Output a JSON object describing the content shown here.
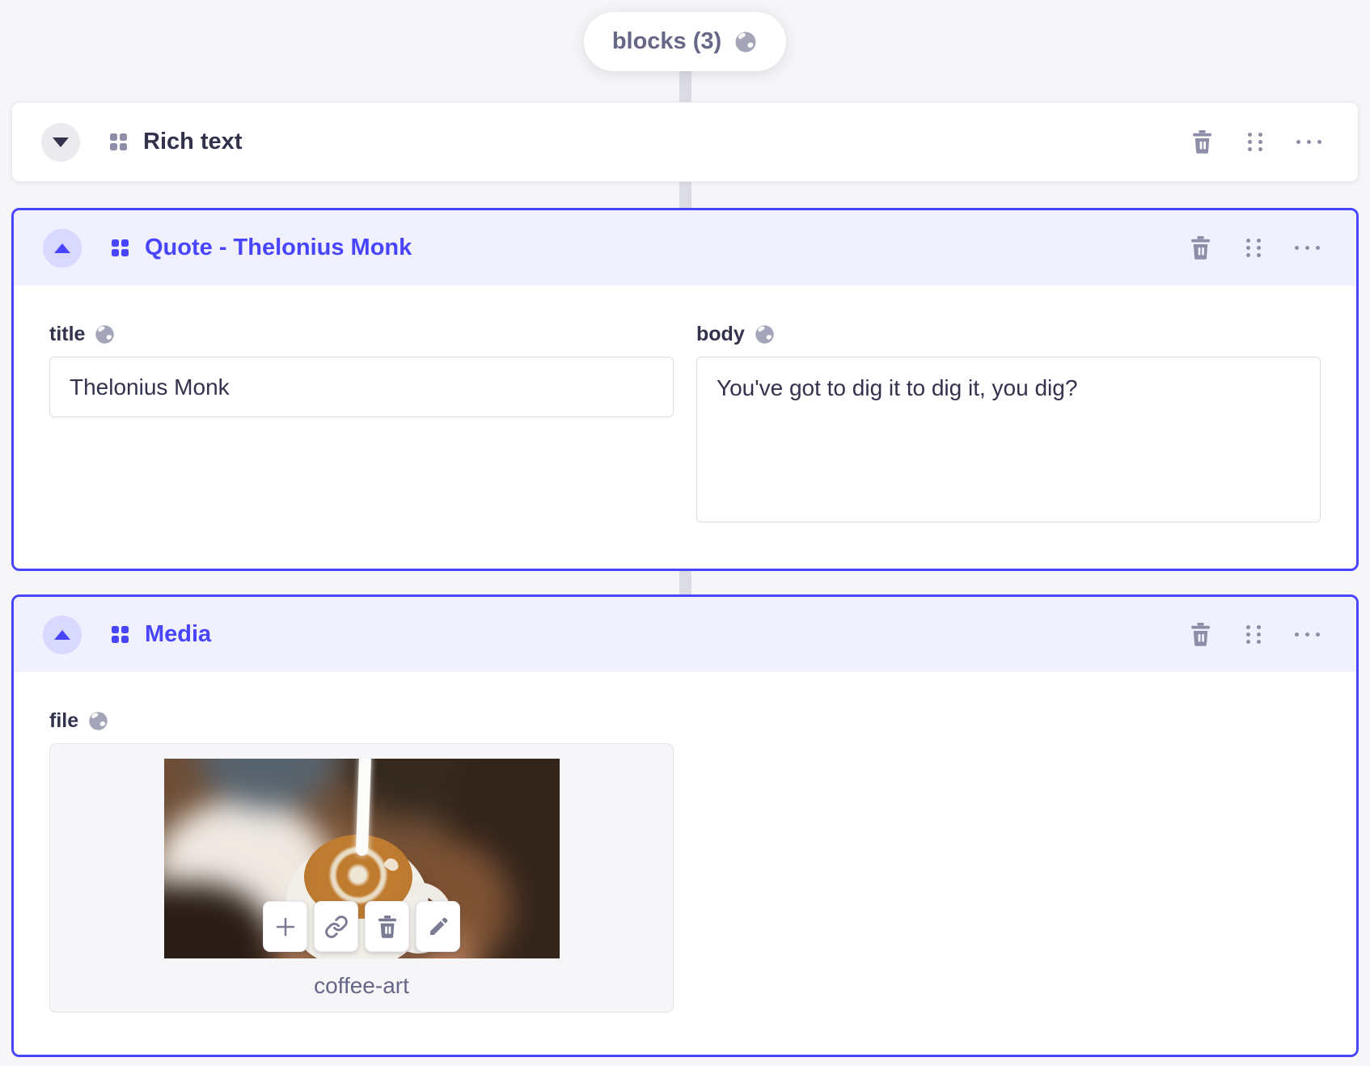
{
  "colors": {
    "primary": "#4945ff",
    "primary_header_bg": "#f0f0ff",
    "primary_toggle_bg": "#d9d8ff",
    "page_bg": "#f6f6f9",
    "icon_gray": "#8e8ea9",
    "text_dark": "#32324d",
    "text_muted": "#666687",
    "connector": "#dcdce4",
    "input_border": "#dcdce4"
  },
  "dynamic_zone": {
    "badge_label": "blocks (3)",
    "badge_icon": "globe-icon"
  },
  "header_action_icons": [
    "trash-icon",
    "drag-handle-icon",
    "more-options-icon"
  ],
  "blocks": [
    {
      "label": "Rich text",
      "state": "collapsed",
      "toggle_icon": "chevron-down-icon",
      "type_icon": "component-blocks-icon"
    },
    {
      "label": "Quote - Thelonius Monk",
      "state": "expanded",
      "toggle_icon": "chevron-up-icon",
      "type_icon": "component-blocks-icon",
      "fields": [
        {
          "label": "title",
          "label_icon": "globe-icon",
          "type": "text-input",
          "value": "Thelonius Monk"
        },
        {
          "label": "body",
          "label_icon": "globe-icon",
          "type": "textarea",
          "value": "You've got to dig it to dig it, you dig?"
        }
      ]
    },
    {
      "label": "Media",
      "state": "expanded",
      "toggle_icon": "chevron-up-icon",
      "type_icon": "component-blocks-icon",
      "fields": [
        {
          "label": "file",
          "label_icon": "globe-icon",
          "type": "media",
          "filename": "coffee-art",
          "action_icons": [
            "plus-icon",
            "link-icon",
            "trash-icon",
            "pencil-icon"
          ]
        }
      ]
    }
  ]
}
